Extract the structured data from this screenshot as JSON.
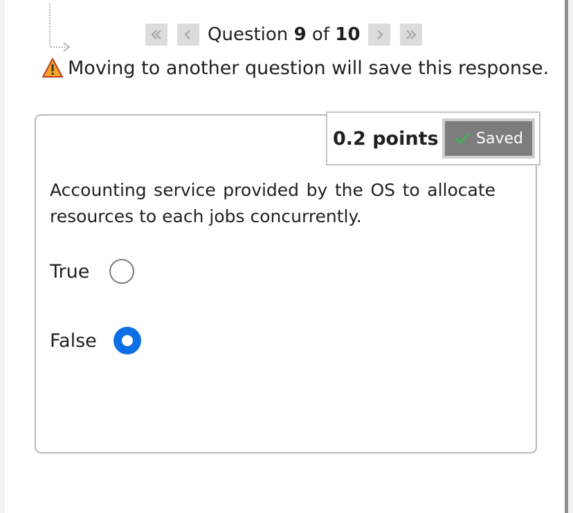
{
  "navigation": {
    "first_icon": "double-chevron-left-icon",
    "prev_icon": "chevron-left-icon",
    "next_icon": "chevron-right-icon",
    "last_icon": "double-chevron-right-icon",
    "counter_prefix": "Question",
    "current": "9",
    "counter_of": "of",
    "total": "10"
  },
  "warning": {
    "icon": "warning-triangle-icon",
    "text": "Moving to another question will save this response."
  },
  "question": {
    "points": "0.2 points",
    "saved_label": "Saved",
    "saved_icon": "checkmark-icon",
    "text": "Accounting service provided by the OS to allocate resources to each jobs concurrently.",
    "options": [
      {
        "label": "True",
        "selected": false
      },
      {
        "label": "False",
        "selected": true
      }
    ]
  },
  "colors": {
    "radio_selected": "#0c6fe6",
    "saved_badge": "#7d7d7d",
    "checkmark": "#3fb34f",
    "warning": "#f5a623"
  }
}
